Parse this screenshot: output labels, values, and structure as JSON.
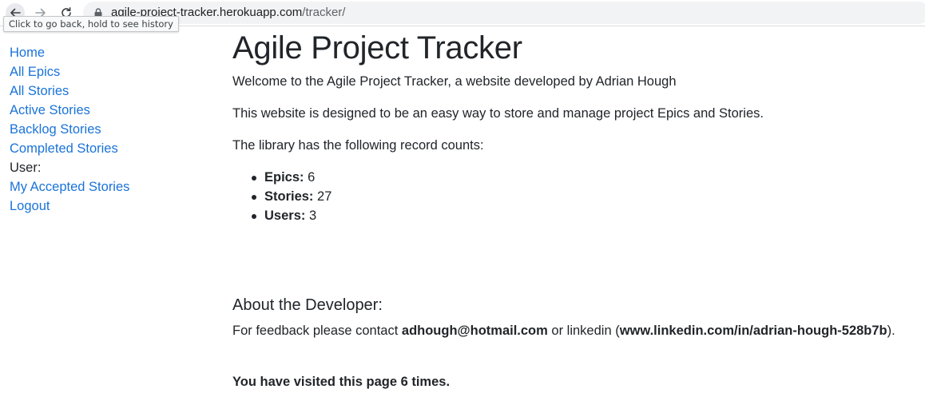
{
  "browser": {
    "url_host": "agile-project-tracker.herokuapp.com",
    "url_path": "/tracker/",
    "tooltip": "Click to go back, hold to see history",
    "icons": {
      "back": "arrow-left-icon",
      "forward": "arrow-right-icon",
      "reload": "reload-icon",
      "lock": "lock-icon"
    }
  },
  "sidebar": {
    "items": [
      {
        "label": "Home",
        "link": true
      },
      {
        "label": "All Epics",
        "link": true
      },
      {
        "label": "All Stories",
        "link": true
      },
      {
        "label": "Active Stories",
        "link": true
      },
      {
        "label": "Backlog Stories",
        "link": true
      },
      {
        "label": "Completed Stories",
        "link": true
      },
      {
        "label": "User:",
        "link": false
      },
      {
        "label": "My Accepted Stories",
        "link": true
      },
      {
        "label": "Logout",
        "link": true
      }
    ],
    "link_color": "#1a73d9"
  },
  "main": {
    "title": "Agile Project Tracker",
    "welcome": "Welcome to the Agile Project Tracker, a website developed by Adrian Hough",
    "purpose": "This website is designed to be an easy way to store and manage project Epics and Stories.",
    "counts_intro": "The library has the following record counts:",
    "counts": [
      {
        "label": "Epics:",
        "value": "6"
      },
      {
        "label": "Stories:",
        "value": "27"
      },
      {
        "label": "Users:",
        "value": "3"
      }
    ],
    "developer_heading": "About the Developer:",
    "feedback_prefix": "For feedback please contact",
    "feedback_email": "adhough@hotmail.com",
    "feedback_middle": "or linkedin (",
    "feedback_linkedin": "www.linkedin.com/in/adrian-hough-528b7b",
    "feedback_suffix": ").",
    "visits": "You have visited this page 6 times."
  }
}
